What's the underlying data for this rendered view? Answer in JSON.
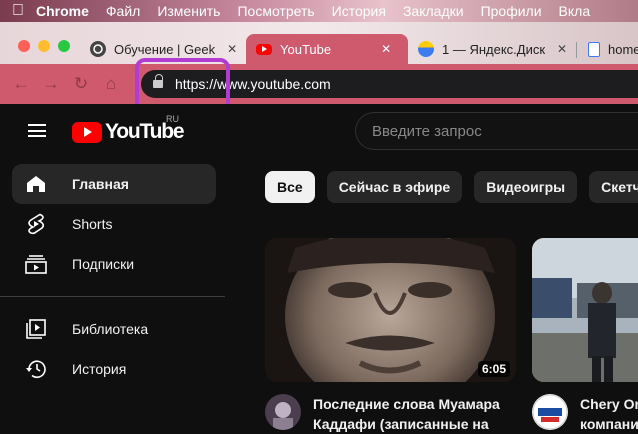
{
  "menubar": {
    "items": [
      "Chrome",
      "Файл",
      "Изменить",
      "Посмотреть",
      "История",
      "Закладки",
      "Профили",
      "Вкла"
    ]
  },
  "tabs": [
    {
      "label": "Обучение | Geek",
      "favicon": "openai-icon",
      "active": false
    },
    {
      "label": "YouTube",
      "favicon": "youtube-icon",
      "active": true
    },
    {
      "label": "1 — Яндекс.Диск",
      "favicon": "yandex-disk-icon",
      "active": false
    },
    {
      "label": "home",
      "favicon": "document-icon",
      "active": false
    }
  ],
  "address": {
    "url_scheme": "https://",
    "url_rest": "www.youtube.com"
  },
  "youtube": {
    "logo_text": "YouTube",
    "country_code": "RU",
    "search_placeholder": "Введите запрос",
    "sidebar": [
      {
        "label": "Главная",
        "icon": "home-icon",
        "active": true
      },
      {
        "label": "Shorts",
        "icon": "shorts-icon",
        "active": false
      },
      {
        "label": "Подписки",
        "icon": "subscriptions-icon",
        "active": false
      },
      {
        "label": "Библиотека",
        "icon": "library-icon",
        "active": false
      },
      {
        "label": "История",
        "icon": "history-icon",
        "active": false
      }
    ],
    "chips": [
      "Все",
      "Сейчас в эфире",
      "Видеоигры",
      "Скетч-ш"
    ],
    "videos": [
      {
        "title": "Последние слова Муамара",
        "title_line2": "Каддафи (записанные на",
        "duration": "6:05"
      },
      {
        "title": "Chery Om",
        "title_line2": "компании",
        "duration": ""
      }
    ]
  },
  "colors": {
    "tab_active": "#cf5a6d",
    "toolbar": "#cf5a6d",
    "highlight": "#b23bd1",
    "yt_bg": "#0f0f0f",
    "yt_red": "#ff0000"
  }
}
